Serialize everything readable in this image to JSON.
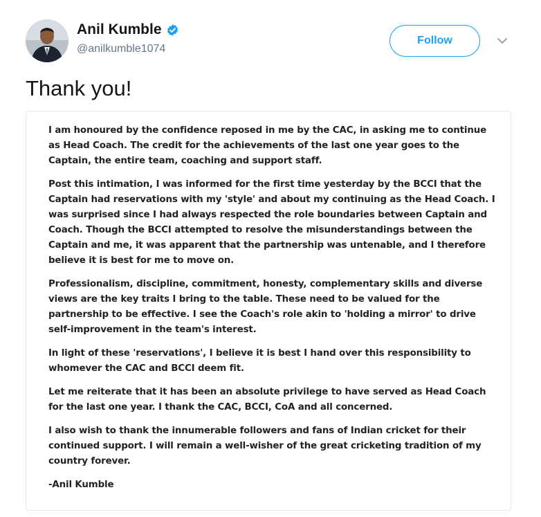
{
  "tweet": {
    "author": {
      "display_name": "Anil Kumble",
      "handle": "@anilkumble1074",
      "verified": true,
      "avatar_icon": "profile-photo"
    },
    "follow_label": "Follow",
    "menu_icon": "chevron-down-icon",
    "text": "Thank you!",
    "accent_color": "#1da1f2"
  },
  "letter": {
    "paragraphs": [
      "I am honoured by the confidence reposed in me by the CAC, in asking me to continue as Head Coach. The credit for the achievements of the last one year goes to the Captain, the entire team, coaching and support staff.",
      "Post this intimation, I was informed for the first time yesterday by the BCCI that the Captain had reservations with my 'style' and about my continuing as the Head Coach. I was surprised since I had always respected the role boundaries between Captain and Coach. Though the BCCI attempted to resolve the misunderstandings between the Captain and me, it was apparent that the partnership was untenable, and I therefore believe it is best for me to move on.",
      "Professionalism, discipline, commitment, honesty, complementary skills and diverse views are the key traits I bring to the table. These need to be valued for the partnership to be effective. I see the Coach's role akin to 'holding a mirror' to drive self-improvement in the team's interest.",
      "In light of these 'reservations', I believe it is best I hand over this responsibility to whomever the CAC and BCCI deem fit.",
      "Let me reiterate that it has been an absolute privilege to have served as Head Coach for the last one year. I thank the CAC, BCCI, CoA and all concerned.",
      "I also wish to thank the innumerable followers and fans of Indian cricket for their continued support. I will remain a well-wisher of the great cricketing tradition of my country forever."
    ],
    "signature": "-Anil Kumble"
  }
}
